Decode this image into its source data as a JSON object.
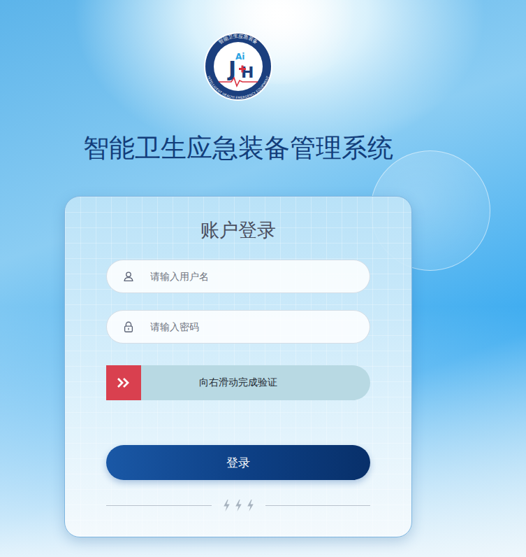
{
  "logo": {
    "ring_top": "智能卫生应急装备",
    "ring_bottom": "INTELLIGENT HEALTH EMERGENCY EQUIPMENT",
    "mark_left": "J",
    "mark_top": "Ai",
    "mark_right": "H"
  },
  "title": "智能卫生应急装备管理系统",
  "card": {
    "title": "账户登录",
    "username": {
      "placeholder": "请输入用户名"
    },
    "password": {
      "placeholder": "请输入密码"
    },
    "slider": {
      "text": "向右滑动完成验证",
      "level": 0
    },
    "login_button": "登录"
  }
}
